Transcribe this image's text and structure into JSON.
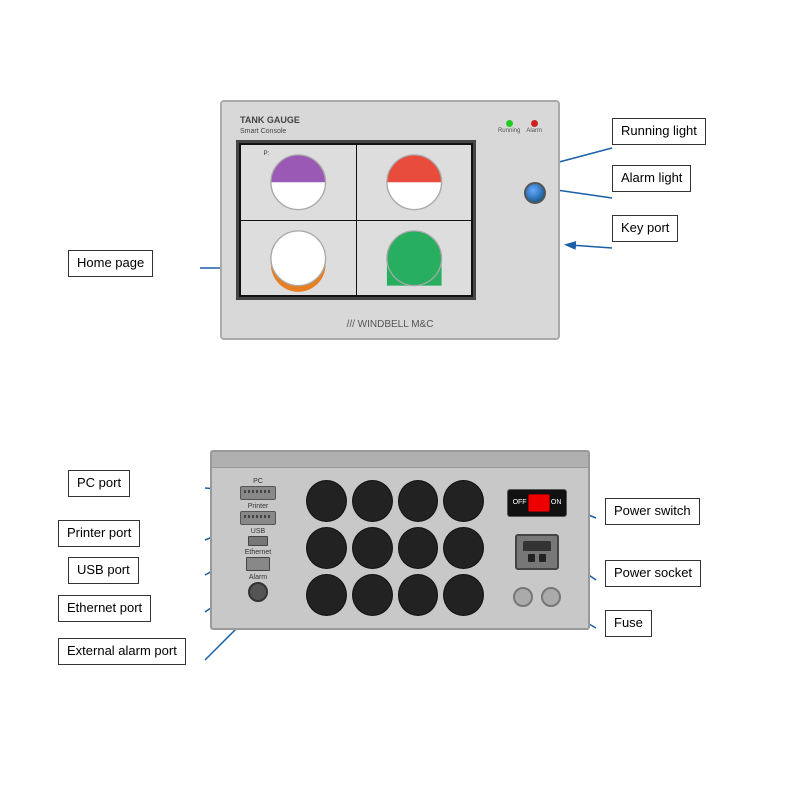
{
  "top_device": {
    "title_line1": "TANK GAUGE",
    "title_line2": "Smart Console",
    "brand": "/// WINDBELL M&C",
    "running_label": "Running",
    "alarm_label": "Alarm"
  },
  "labels": {
    "running_light": "Running light",
    "alarm_light": "Alarm light",
    "key_port": "Key port",
    "home_page": "Home page",
    "pc_port": "PC port",
    "printer_port": "Printer port",
    "usb_port": "USB port",
    "ethernet_port": "Ethernet port",
    "external_alarm_port": "External alarm port",
    "power_switch": "Power switch",
    "power_socket": "Power socket",
    "fuse": "Fuse"
  },
  "panel": {
    "pc_label": "PC",
    "printer_label": "Printer",
    "usb_label": "USB",
    "ethernet_label": "Ethernet",
    "alarm_label": "Alarm",
    "off_text": "OFF",
    "on_text": "ON"
  },
  "colors": {
    "accent": "#1a5fa8",
    "label_border": "#333333",
    "arrow": "#1a5fa8",
    "light_green": "#22cc22",
    "light_red": "#cc2222"
  }
}
